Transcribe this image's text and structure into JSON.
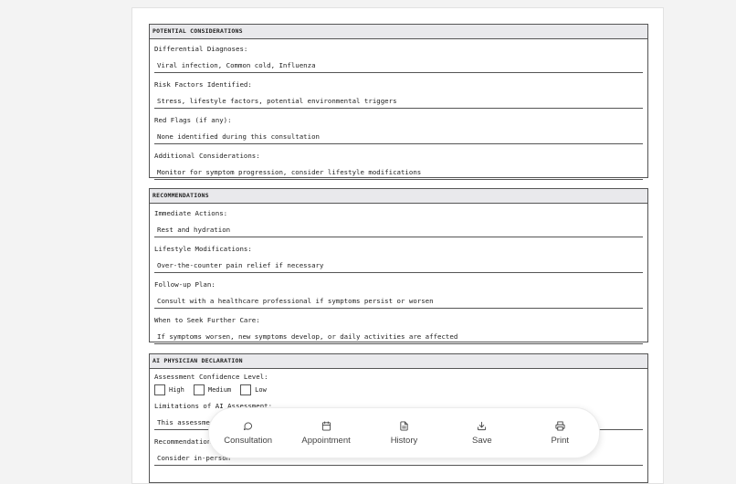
{
  "sections": {
    "potential": {
      "title": "POTENTIAL CONSIDERATIONS",
      "fields": [
        {
          "label": "Differential Diagnoses:",
          "value": "Viral infection, Common cold, Influenza"
        },
        {
          "label": "Risk Factors Identified:",
          "value": "Stress, lifestyle factors, potential environmental triggers"
        },
        {
          "label": "Red Flags (if any):",
          "value": "None identified during this consultation"
        },
        {
          "label": "Additional Considerations:",
          "value": "Monitor for symptom progression, consider lifestyle modifications"
        }
      ]
    },
    "recommendations": {
      "title": "RECOMMENDATIONS",
      "fields": [
        {
          "label": "Immediate Actions:",
          "value": "Rest and hydration"
        },
        {
          "label": "Lifestyle Modifications:",
          "value": "Over-the-counter pain relief if necessary"
        },
        {
          "label": "Follow-up Plan:",
          "value": "Consult with a healthcare professional if symptoms persist or worsen"
        },
        {
          "label": "When to Seek Further Care:",
          "value": "If symptoms worsen, new symptoms develop, or daily activities are affected"
        }
      ]
    },
    "declaration": {
      "title": "AI PHYSICIAN DECLARATION",
      "confidence_label": "Assessment Confidence Level:",
      "options": [
        "High",
        "Medium",
        "Low"
      ],
      "fields": [
        {
          "label": "Limitations of AI Assessment:",
          "value": "This assessment"
        },
        {
          "label": "Recommendation v",
          "value": "Consider in-person"
        }
      ]
    }
  },
  "bottom_nav": [
    {
      "label": "Consultation",
      "icon": "chat-bubble-icon"
    },
    {
      "label": "Appointment",
      "icon": "calendar-icon"
    },
    {
      "label": "History",
      "icon": "document-icon"
    },
    {
      "label": "Save",
      "icon": "download-icon"
    },
    {
      "label": "Print",
      "icon": "printer-icon"
    }
  ]
}
